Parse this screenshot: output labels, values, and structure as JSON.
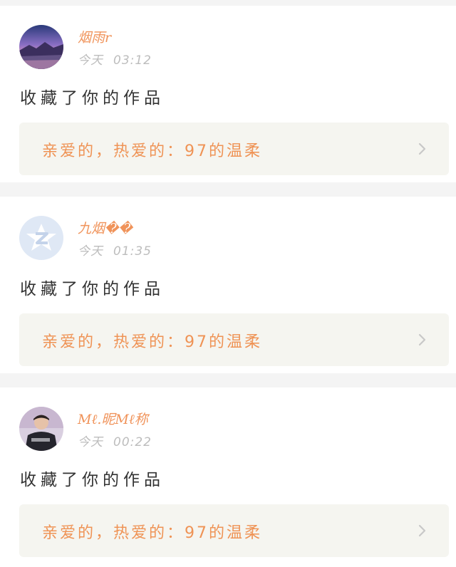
{
  "notifications": [
    {
      "username": "烟雨r",
      "day": "今天",
      "time": "03:12",
      "action": "收藏了你的作品",
      "work_title": "亲爱的，热爱的：97的温柔",
      "avatar_icon": "aurora-landscape-avatar",
      "chevron_icon": "chevron-right-icon"
    },
    {
      "username": "九烟��",
      "day": "今天",
      "time": "01:35",
      "action": "收藏了你的作品",
      "work_title": "亲爱的，热爱的：97的温柔",
      "avatar_icon": "qq-default-avatar",
      "chevron_icon": "chevron-right-icon"
    },
    {
      "username": "Mℓ.昵Mℓ称",
      "day": "今天",
      "time": "00:22",
      "action": "收藏了你的作品",
      "work_title": "亲爱的，热爱的：97的温柔",
      "avatar_icon": "person-photo-avatar",
      "chevron_icon": "chevron-right-icon"
    }
  ],
  "colors": {
    "accent": "#ef9355",
    "card_background": "#ffffff",
    "page_background": "#f4f4f4",
    "work_background": "#f5f5f0",
    "muted_text": "#bdbdbd"
  }
}
